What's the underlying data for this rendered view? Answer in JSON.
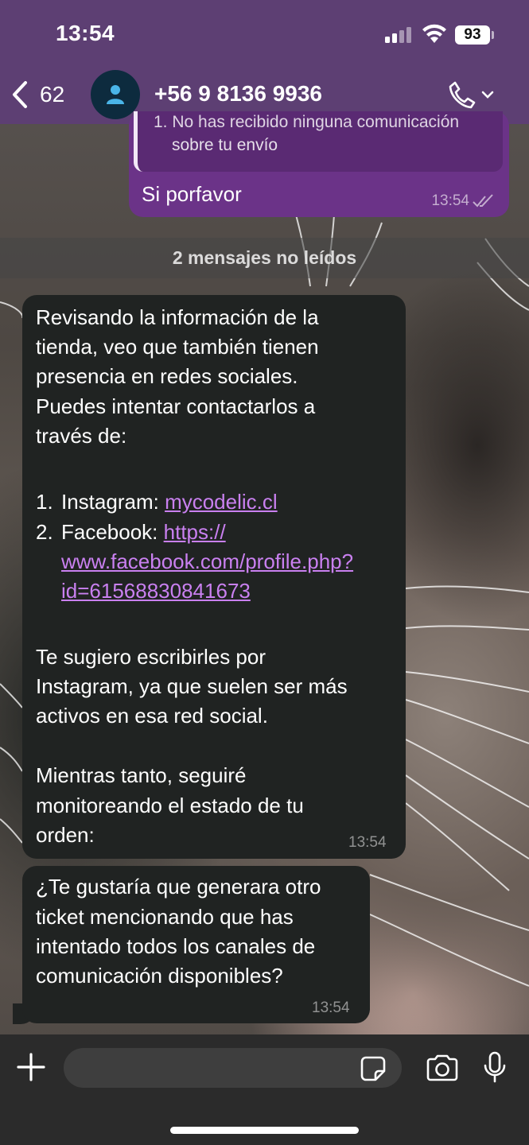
{
  "status_bar": {
    "time": "13:54",
    "battery": "93"
  },
  "header": {
    "back_count": "62",
    "contact": "+56 9 8136 9936",
    "accent_color": "#5d3f73"
  },
  "outgoing": {
    "quote_line1": "1. No has recibido ninguna comunicación",
    "quote_line2": "sobre tu envío",
    "text": "Si porfavor",
    "time": "13:54",
    "bubble_color": "#6b3388"
  },
  "unread_divider": "2 mensajes no leídos",
  "incoming_1": {
    "p1_l1": "Revisando la información de la",
    "p1_l2": "tienda, veo que también tienen",
    "p1_l3": "presencia en redes sociales.",
    "p1_l4": "Puedes intentar contactarlos a",
    "p1_l5": "través de:",
    "item1_num": "1.",
    "item1_label": "Instagram: ",
    "item1_link": "mycodelic.cl",
    "item2_num": "2.",
    "item2_label": "Facebook: ",
    "item2_link_l1": "https://",
    "item2_link_l2": "www.facebook.com/profile.php?",
    "item2_link_l3": "id=61568830841673",
    "p2_l1": "Te sugiero escribirles por",
    "p2_l2": "Instagram, ya que suelen ser más",
    "p2_l3": "activos en esa red social.",
    "p3_l1": "Mientras tanto, seguiré",
    "p3_l2": "monitoreando el estado de tu",
    "p3_l3": "orden:",
    "time": "13:54",
    "link_color": "#c980f0"
  },
  "incoming_2": {
    "l1": "¿Te gustaría que generara otro",
    "l2": "ticket mencionando que has",
    "l3": "intentado todos los canales de",
    "l4": "comunicación disponibles?",
    "time": "13:54"
  },
  "input_bar": {
    "message_value": ""
  },
  "icons": [
    "chevron-left-icon",
    "person-icon",
    "phone-icon",
    "chevron-down-icon",
    "double-check-icon",
    "plus-icon",
    "sticker-icon",
    "camera-icon",
    "microphone-icon",
    "signal-icon",
    "wifi-icon"
  ]
}
